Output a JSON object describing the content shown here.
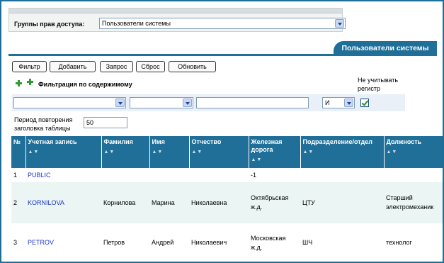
{
  "access_group": {
    "label": "Группы прав доступа:",
    "selected": "Пользователи системы"
  },
  "tab": {
    "label": "Пользователи системы"
  },
  "toolbar": {
    "filter": "Фильтр",
    "add": "Добавить",
    "query": "Запрос",
    "reset": "Сброс",
    "refresh": "Обновить"
  },
  "filter": {
    "title": "Фильтрация по содержимому",
    "case_label": "Не учитывать регистр",
    "operator": "И",
    "case_checked": true
  },
  "period": {
    "label_line1": "Период повторения",
    "label_line2": "заголовка таблицы",
    "value": "50"
  },
  "table": {
    "columns": [
      "№",
      "Учетная запись",
      "Фамилия",
      "Имя",
      "Отчество",
      "Железная дорога",
      "Подразделение/отдел",
      "Должность"
    ],
    "sort_glyph": "▲▼",
    "rows": [
      {
        "num": "1",
        "login": "PUBLIC",
        "last": "",
        "first": "",
        "middle": "",
        "railway": "-1",
        "dept": "",
        "position": ""
      },
      {
        "num": "2",
        "login": "KORNILOVA",
        "last": "Корнилова",
        "first": "Марина",
        "middle": "Николаевна",
        "railway": "Октябрьская ж.д.",
        "dept": "ЦТУ",
        "position": "Старший электромеханик"
      },
      {
        "num": "3",
        "login": "PETROV",
        "last": "Петров",
        "first": "Андрей",
        "middle": "Николаевич",
        "railway": "Московская ж.д.",
        "dept": "ШЧ",
        "position": "технолог"
      }
    ]
  },
  "colors": {
    "accent": "#1f6f99",
    "link": "#1a35c4",
    "row_alt": "#eaf5f4"
  }
}
